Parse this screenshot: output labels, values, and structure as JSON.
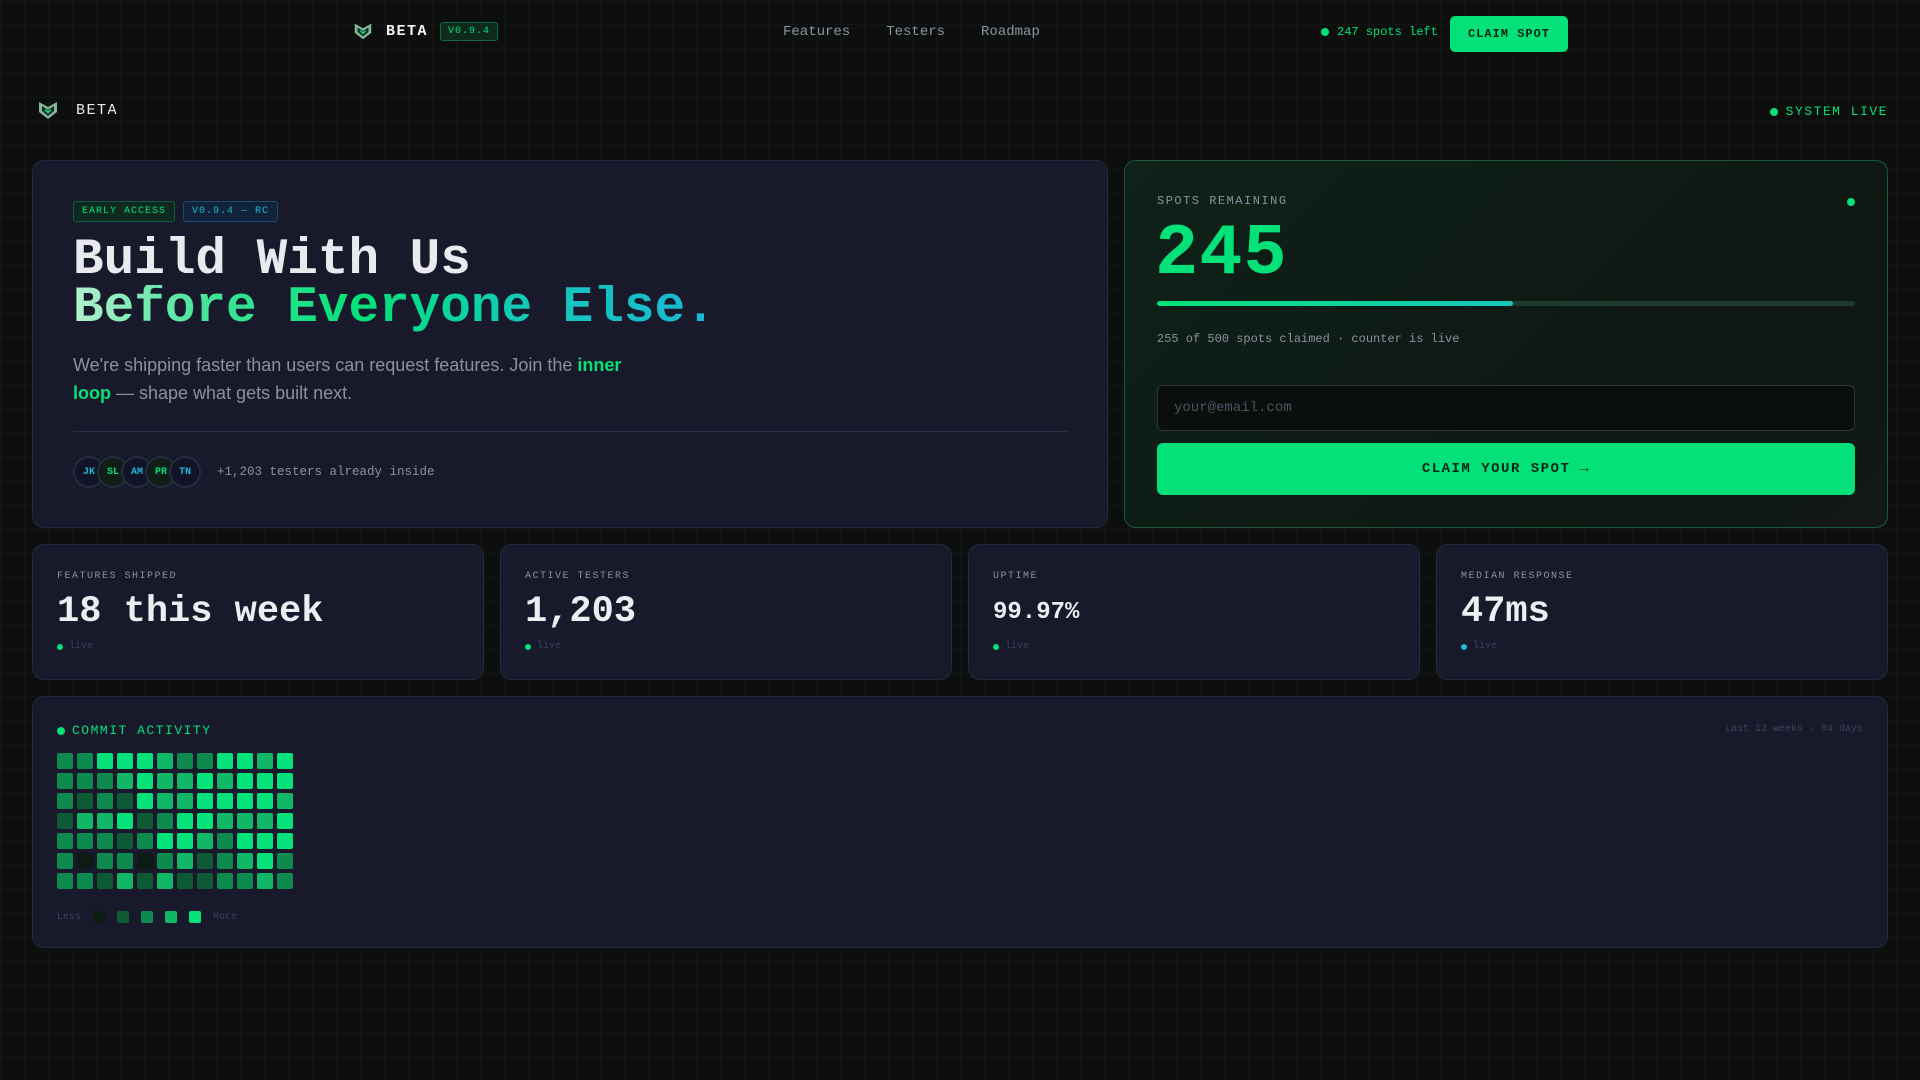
{
  "nav": {
    "brand": "BETA",
    "version": "V0.9.4",
    "links": [
      "Features",
      "Testers",
      "Roadmap"
    ],
    "spots_left": "247 spots left",
    "claim_label": "CLAIM SPOT"
  },
  "subbar": {
    "brand": "BETA",
    "status": "SYSTEM LIVE"
  },
  "hero": {
    "tags": [
      "EARLY ACCESS",
      "V0.9.4 — RC"
    ],
    "title_line1": "Build With Us",
    "title_line2": "Before Everyone Else.",
    "subtitle_before": "We're shipping faster than users can request features. Join the ",
    "subtitle_highlight": "inner loop",
    "subtitle_after": " — shape what gets built next.",
    "avatars": [
      "JK",
      "SL",
      "AM",
      "PR",
      "TN"
    ],
    "testers_text": "+1,203 testers already inside"
  },
  "spots": {
    "label": "SPOTS REMAINING",
    "count": "245",
    "progress_fraction": 0.51,
    "note": "255 of 500 spots claimed · counter is live",
    "email_placeholder": "your@email.com",
    "cta_label": "CLAIM YOUR SPOT →"
  },
  "stats": [
    {
      "label": "FEATURES SHIPPED",
      "value": "18 this week",
      "live": "live"
    },
    {
      "label": "ACTIVE TESTERS",
      "value": "1,203",
      "live": "live"
    },
    {
      "label": "UPTIME",
      "value": "99.97%",
      "live": "live"
    },
    {
      "label": "MEDIAN RESPONSE",
      "value": "47ms",
      "live": "live"
    }
  ],
  "activity": {
    "title": "COMMIT ACTIVITY",
    "range": "Last 12 weeks · 84 days",
    "legend_less": "Less",
    "legend_more": "More",
    "levels": [
      [
        2,
        2,
        2,
        1,
        2,
        2,
        2
      ],
      [
        2,
        2,
        1,
        3,
        2,
        0,
        2
      ],
      [
        4,
        2,
        2,
        3,
        2,
        2,
        1
      ],
      [
        4,
        3,
        1,
        4,
        1,
        2,
        3
      ],
      [
        4,
        4,
        4,
        1,
        2,
        0,
        1
      ],
      [
        3,
        3,
        3,
        2,
        4,
        2,
        3
      ],
      [
        2,
        3,
        3,
        4,
        4,
        3,
        1
      ],
      [
        2,
        4,
        4,
        4,
        3,
        1,
        1
      ],
      [
        4,
        3,
        4,
        3,
        2,
        2,
        2
      ],
      [
        4,
        4,
        4,
        3,
        4,
        3,
        2
      ],
      [
        3,
        4,
        4,
        3,
        4,
        4,
        3
      ],
      [
        4,
        4,
        3,
        4,
        4,
        2,
        2
      ]
    ],
    "palette": [
      "#0e1a14",
      "#0d5a34",
      "#0f8a4f",
      "#12b765",
      "#04e178"
    ]
  },
  "colors": {
    "accent": "#04e178",
    "accent_cyan": "#1bb9d6",
    "card_bg": "#181a2c",
    "page_bg": "#0c0f0d"
  }
}
